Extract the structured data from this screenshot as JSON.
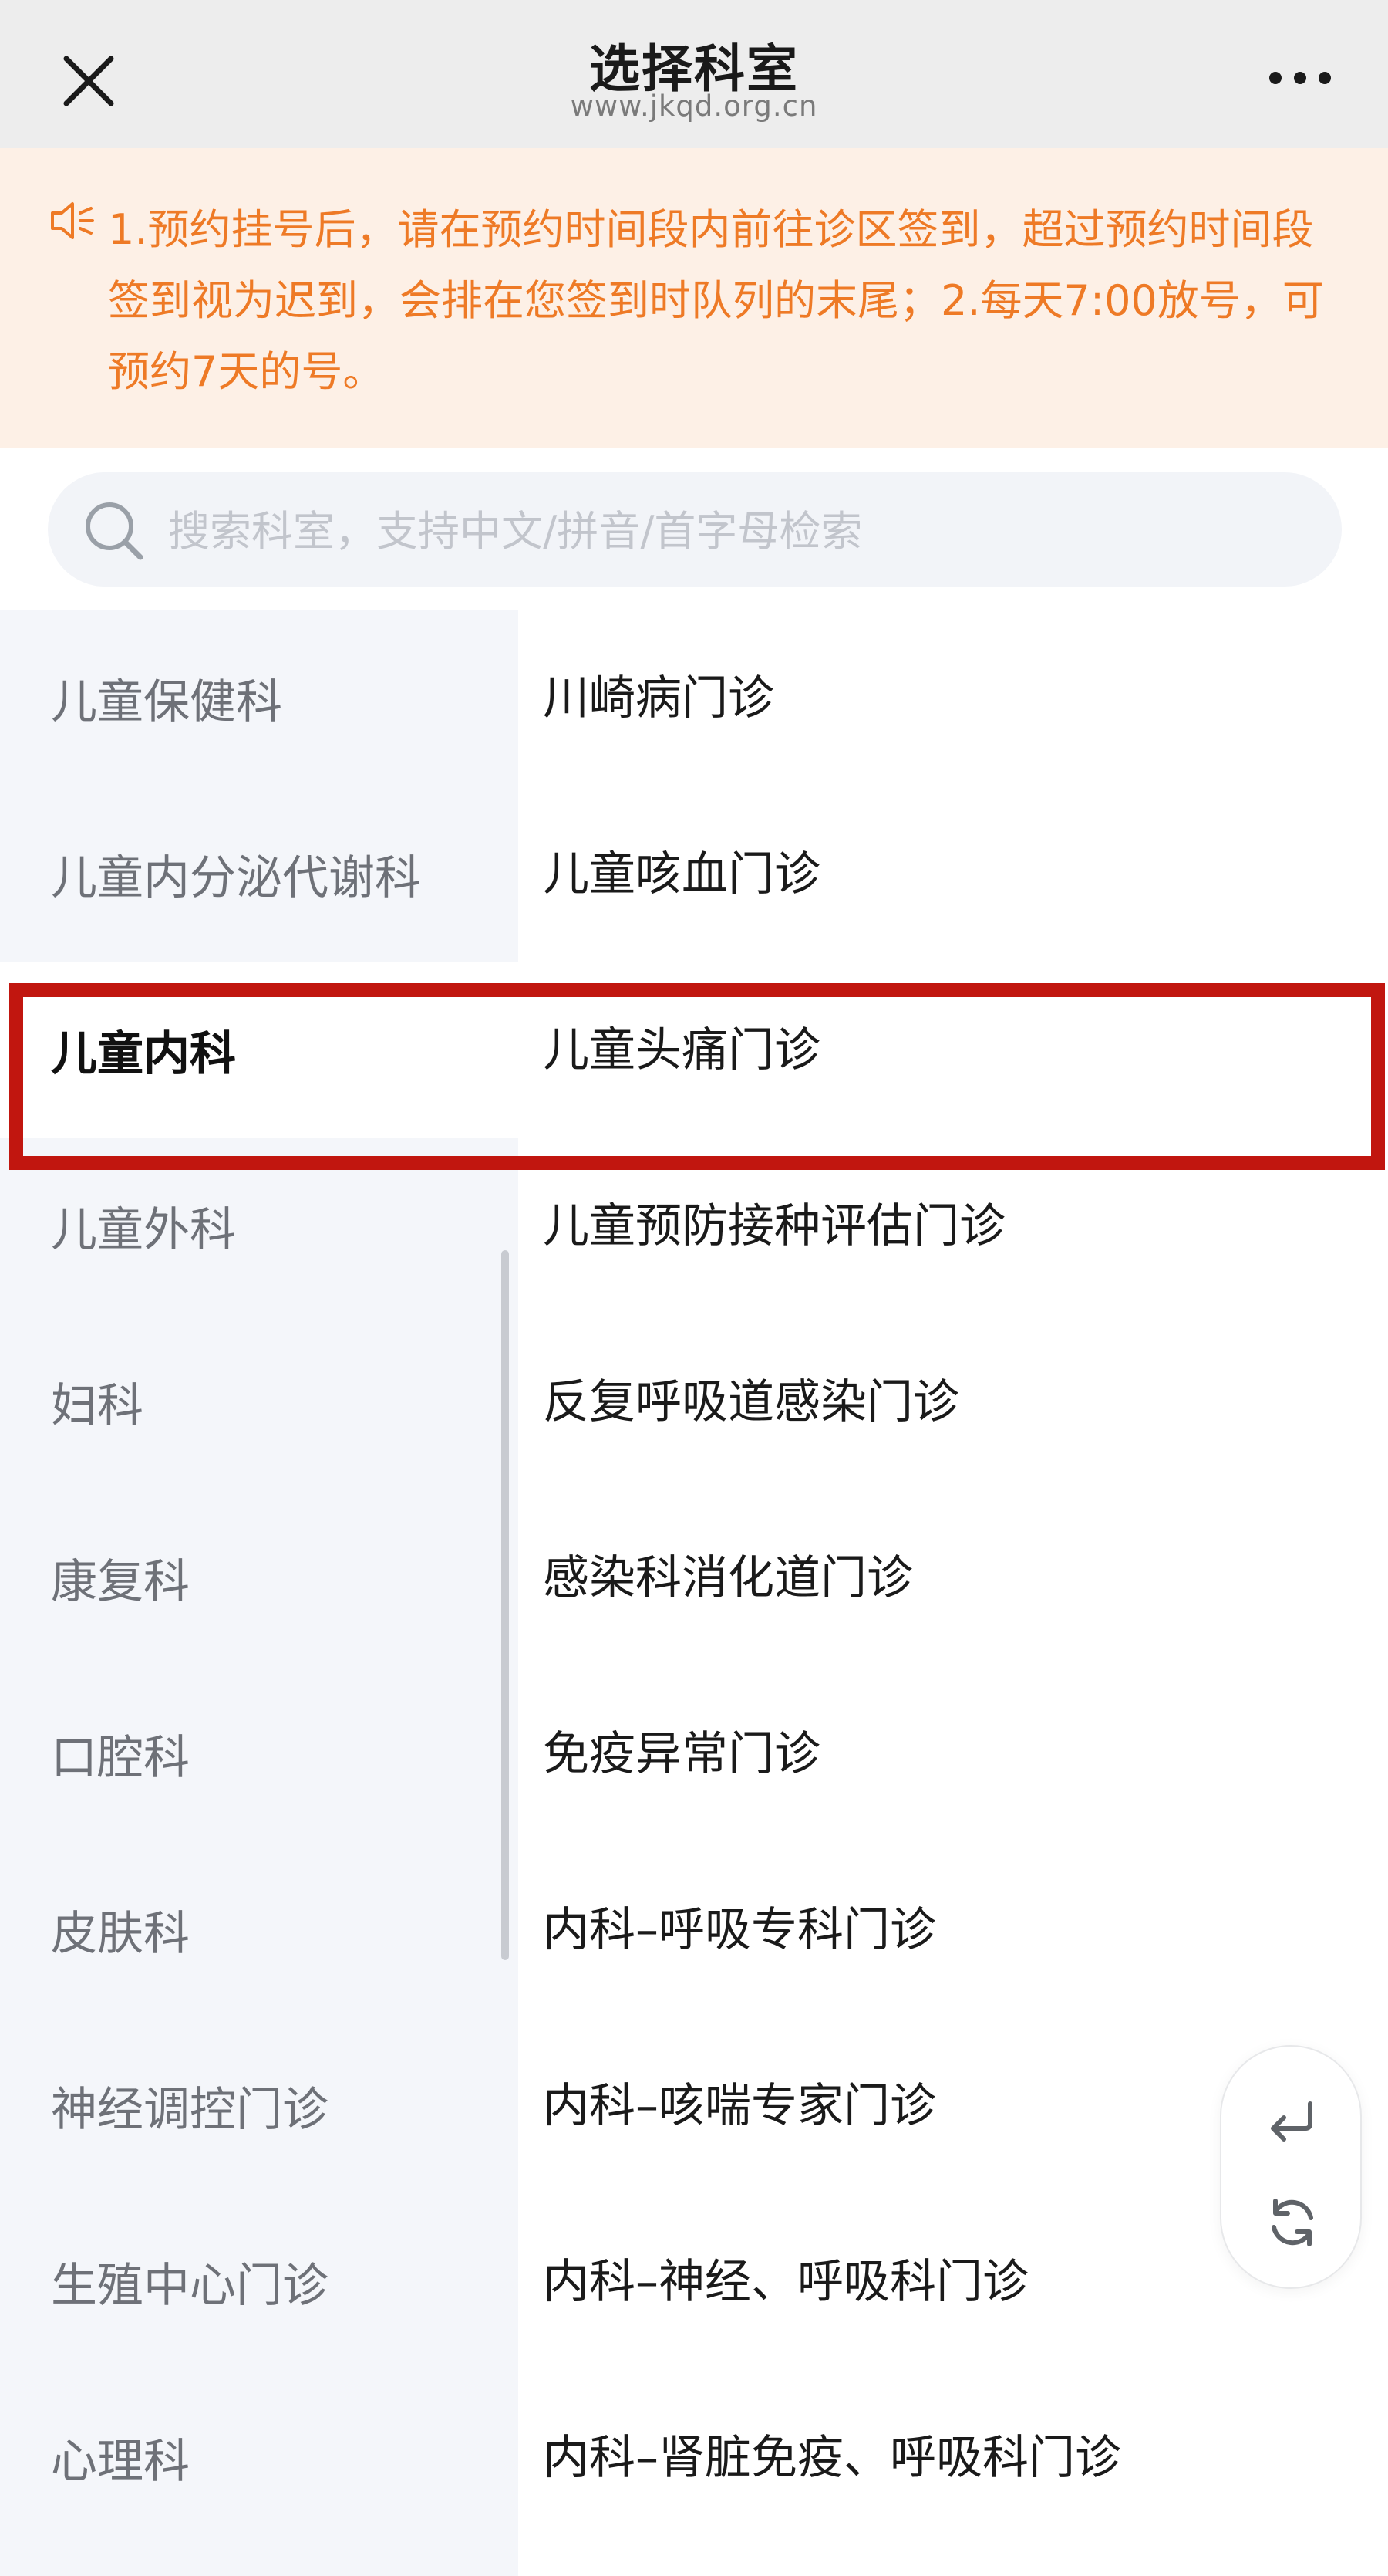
{
  "header": {
    "title": "选择科室",
    "subtitle": "www.jkqd.org.cn",
    "close_icon": "close-icon",
    "more_icon": "more-icon"
  },
  "notice": {
    "icon": "speaker-icon",
    "text": "1.预约挂号后，请在预约时间段内前往诊区签到，超过预约时间段签到视为迟到，会排在您签到时队列的末尾；2.每天7:00放号，可预约7天的号。"
  },
  "search": {
    "placeholder": "搜索科室，支持中文/拼音/首字母检索",
    "icon": "search-icon"
  },
  "departments": [
    {
      "label": "儿童保健科"
    },
    {
      "label": "儿童内分泌代谢科"
    },
    {
      "label": "儿童内科",
      "active": true
    },
    {
      "label": "儿童外科"
    },
    {
      "label": "妇科"
    },
    {
      "label": "康复科"
    },
    {
      "label": "口腔科"
    },
    {
      "label": "皮肤科"
    },
    {
      "label": "神经调控门诊"
    },
    {
      "label": "生殖中心门诊"
    },
    {
      "label": "心理科"
    }
  ],
  "clinics": [
    {
      "label": "川崎病门诊"
    },
    {
      "label": "儿童咳血门诊"
    },
    {
      "label": "儿童头痛门诊"
    },
    {
      "label": "儿童预防接种评估门诊"
    },
    {
      "label": "反复呼吸道感染门诊"
    },
    {
      "label": "感染科消化道门诊"
    },
    {
      "label": "免疫异常门诊"
    },
    {
      "label": "内科–呼吸专科门诊"
    },
    {
      "label": "内科–咳喘专家门诊"
    },
    {
      "label": "内科–神经、呼吸科门诊"
    },
    {
      "label": "内科–肾脏免疫、呼吸科门诊"
    }
  ],
  "float_actions": {
    "back_icon": "return-icon",
    "refresh_icon": "refresh-icon"
  },
  "colors": {
    "notice_text": "#ee7a26",
    "notice_bg": "#fdf0e6",
    "highlight_border": "#c1160f"
  }
}
